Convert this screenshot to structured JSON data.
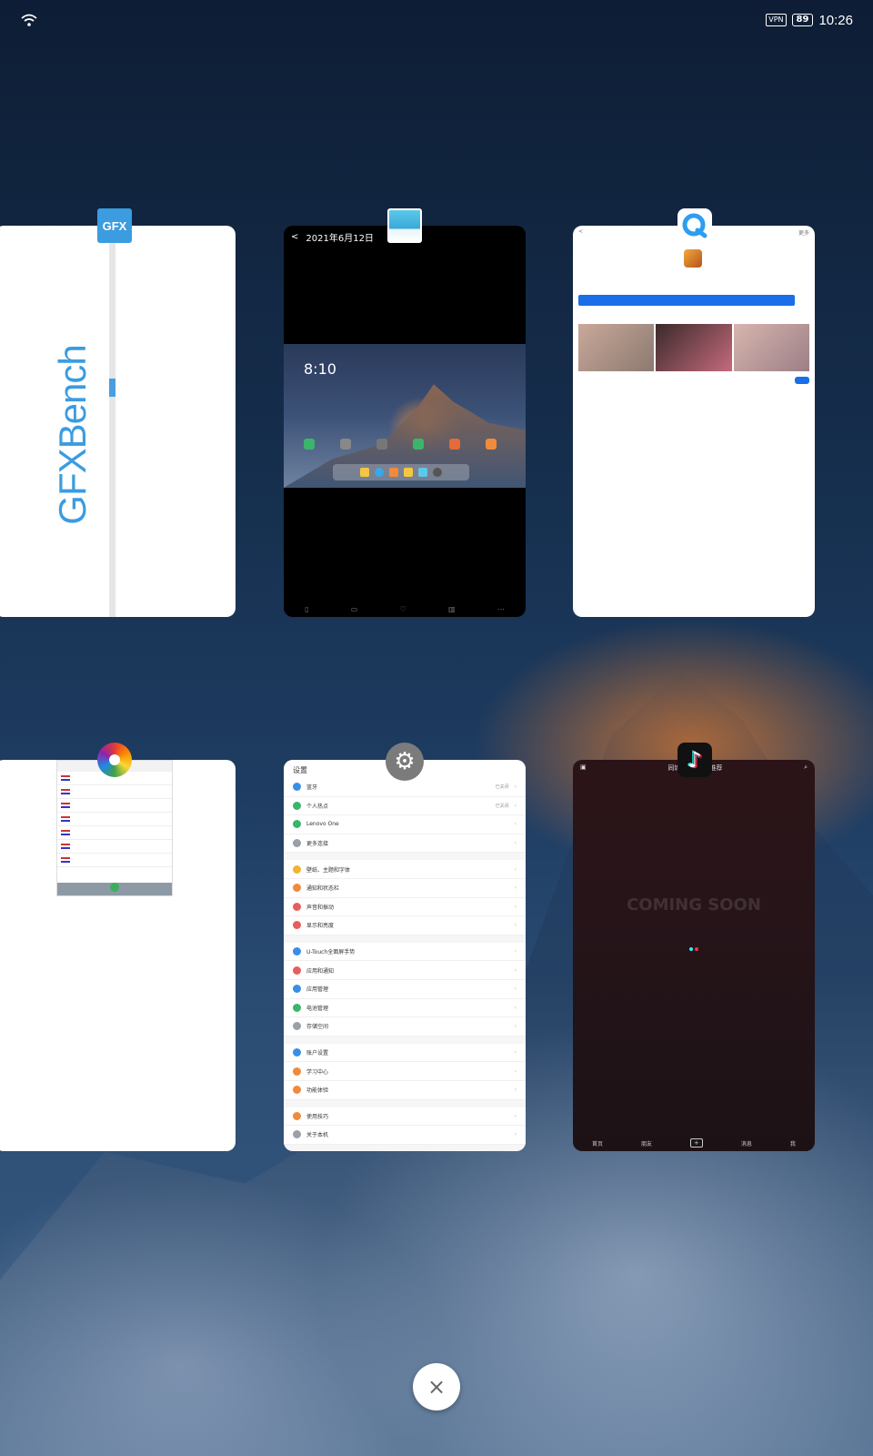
{
  "status_bar": {
    "wifi_icon": "wifi-icon",
    "vpn": "VPN",
    "battery": "89",
    "time": "10:26"
  },
  "cards": {
    "gfxbench": {
      "icon_label": "GFX",
      "brand": "GFXBench"
    },
    "gallery": {
      "back": "<",
      "date": "2021年6月12日",
      "preview_time": "8:10",
      "footer": [
        "▯",
        "▭",
        "♡",
        "▥",
        "⋯"
      ]
    },
    "browser": {
      "back": "<",
      "corner": "更多"
    },
    "settings": {
      "title": "设置",
      "groups": [
        [
          {
            "label": "蓝牙",
            "value": "已关闭",
            "color": "#3a8ee6"
          },
          {
            "label": "个人热点",
            "value": "已关闭",
            "color": "#3bb56a"
          },
          {
            "label": "Lenovo One",
            "value": "",
            "color": "#3bb56a"
          },
          {
            "label": "更多连接",
            "value": "",
            "color": "#9aa0a6"
          }
        ],
        [
          {
            "label": "壁纸、主题和字体",
            "value": "",
            "color": "#f2b233"
          },
          {
            "label": "通知和状态栏",
            "value": "",
            "color": "#f08a3c"
          },
          {
            "label": "声音和振动",
            "value": "",
            "color": "#e85d5d"
          },
          {
            "label": "显示和亮度",
            "value": "",
            "color": "#e85d5d"
          }
        ],
        [
          {
            "label": "U-Touch全面屏手势",
            "value": "",
            "color": "#3a8ee6"
          },
          {
            "label": "应用和通知",
            "value": "",
            "color": "#e85d5d"
          },
          {
            "label": "应用管理",
            "value": "",
            "color": "#3a8ee6"
          },
          {
            "label": "电池管理",
            "value": "",
            "color": "#3bb56a"
          },
          {
            "label": "存储空间",
            "value": "",
            "color": "#9aa0a6"
          }
        ],
        [
          {
            "label": "账户设置",
            "value": "",
            "color": "#3a8ee6"
          },
          {
            "label": "学习中心",
            "value": "",
            "color": "#f08a3c"
          },
          {
            "label": "功能体验",
            "value": "",
            "color": "#f08a3c"
          }
        ],
        [
          {
            "label": "使用技巧",
            "value": "",
            "color": "#f08a3c"
          },
          {
            "label": "关于本机",
            "value": "",
            "color": "#9aa0a6"
          }
        ]
      ]
    },
    "tiktok": {
      "tabs": [
        "同城",
        "推荐"
      ],
      "watermark": "COMING SOON",
      "nav": [
        "首页",
        "朋友",
        "+",
        "消息",
        "我"
      ]
    }
  },
  "close_button": "×",
  "colors": {
    "gfx_blue": "#3b9ce0",
    "browser_blue": "#1a6ee8"
  }
}
